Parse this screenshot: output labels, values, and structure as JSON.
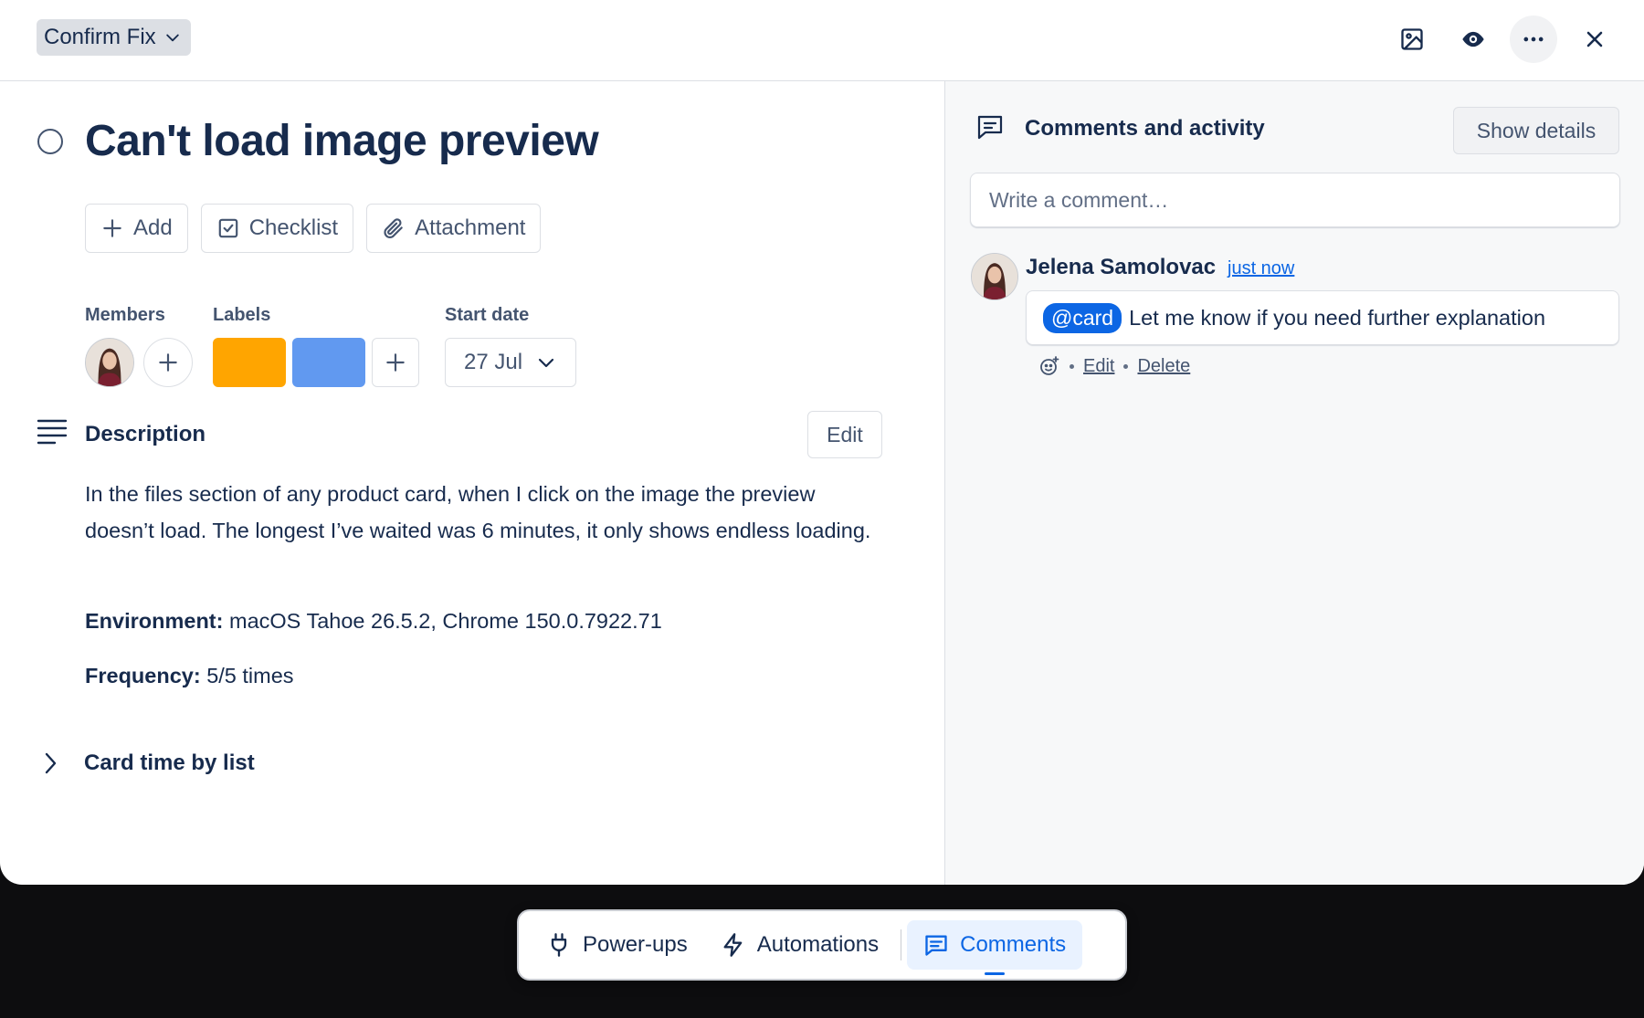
{
  "header": {
    "list_name": "Confirm Fix",
    "icons": [
      "image-icon",
      "eye-icon",
      "more-icon",
      "close-icon"
    ]
  },
  "card": {
    "title": "Can't load image preview",
    "actions": [
      {
        "label": "Add",
        "icon": "plus-icon"
      },
      {
        "label": "Checklist",
        "icon": "checkbox-icon"
      },
      {
        "label": "Attachment",
        "icon": "paperclip-icon"
      }
    ],
    "members_label": "Members",
    "labels_label": "Labels",
    "labels": [
      {
        "color": "#ffa500"
      },
      {
        "color": "#6199f0"
      }
    ],
    "start_date_label": "Start date",
    "start_date": "27 Jul",
    "description": {
      "heading": "Description",
      "edit_label": "Edit",
      "body": "In the files section of any product card, when I click on the image the preview doesn’t load. The longest I’ve waited was 6 minutes, it only shows endless loading.",
      "environment_label": "Environment:",
      "environment_value": " macOS Tahoe 26.5.2, Chrome 150.0.7922.71",
      "frequency_label": "Frequency:",
      "frequency_value": " 5/5 times"
    },
    "time_by_list": "Card time by list"
  },
  "comments": {
    "title": "Comments and activity",
    "show_details": "Show details",
    "input_placeholder": "Write a comment…",
    "items": [
      {
        "author": "Jelena Samolovac",
        "time": "just now",
        "mention": "@card",
        "text": "Let me know if you need further explanation",
        "edit": "Edit",
        "delete": "Delete"
      }
    ]
  },
  "dock": {
    "items": [
      {
        "label": "Power-ups",
        "icon": "plug-icon"
      },
      {
        "label": "Automations",
        "icon": "lightning-icon"
      },
      {
        "label": "Comments",
        "icon": "comment-icon",
        "active": true
      }
    ]
  },
  "colors": {
    "accent": "#0c66e4",
    "label_orange": "#ffa500",
    "label_blue": "#6199f0"
  }
}
